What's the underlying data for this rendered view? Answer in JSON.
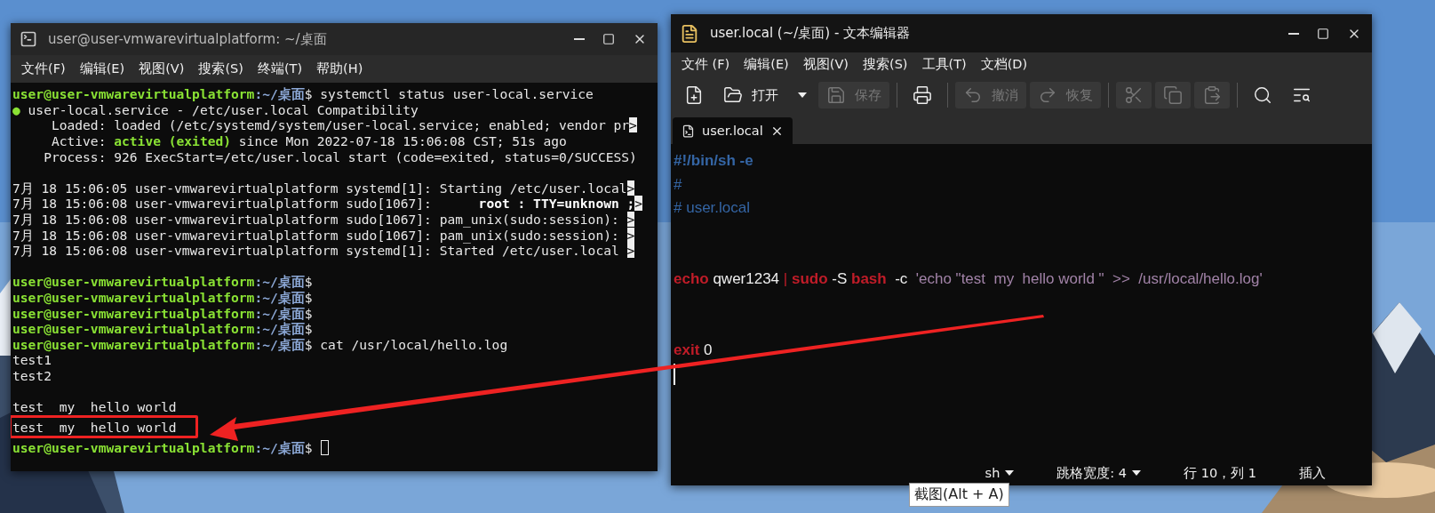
{
  "terminal": {
    "title": "user@user-vmwarevirtualplatform: ~/桌面",
    "menu": [
      "文件(F)",
      "编辑(E)",
      "视图(V)",
      "搜索(S)",
      "终端(T)",
      "帮助(H)"
    ],
    "lines": [
      {
        "kind": "text",
        "segments": [
          {
            "text": "user@user-vmwarevirtualplatform",
            "kind": "user"
          },
          {
            "text": ":~/桌面",
            "kind": "path"
          },
          {
            "text": "$ systemctl status user-local.service",
            "kind": "plain"
          }
        ]
      },
      {
        "kind": "text",
        "segments": [
          {
            "text": "●",
            "kind": "dot"
          },
          {
            "text": " user-local.service - /etc/user.local Compatibility",
            "kind": "plain"
          }
        ]
      },
      {
        "kind": "text",
        "segments": [
          {
            "text": "     Loaded: loaded (/etc/systemd/system/user-local.service; enabled; vendor pr",
            "kind": "plain"
          },
          {
            "text": ">",
            "kind": "more"
          }
        ]
      },
      {
        "kind": "text",
        "segments": [
          {
            "text": "     Active: ",
            "kind": "plain"
          },
          {
            "text": "active (exited)",
            "kind": "active"
          },
          {
            "text": " since Mon 2022-07-18 15:06:08 CST; 51s ago",
            "kind": "plain"
          }
        ]
      },
      {
        "kind": "text",
        "segments": [
          {
            "text": "    Process: 926 ExecStart=/etc/user.local start (code=exited, status=0/SUCCESS)",
            "kind": "plain"
          }
        ]
      },
      {
        "kind": "blank"
      },
      {
        "kind": "text",
        "segments": [
          {
            "text": "7月 18 15:06:05 user-vmwarevirtualplatform systemd[1]: Starting /etc/user.local",
            "kind": "plain"
          },
          {
            "text": ">",
            "kind": "more"
          }
        ]
      },
      {
        "kind": "text",
        "segments": [
          {
            "text": "7月 18 15:06:08 user-vmwarevirtualplatform sudo[1067]:     ",
            "kind": "plain"
          },
          {
            "text": " root : TTY=unknown ;",
            "kind": "bold"
          },
          {
            "text": ">",
            "kind": "more"
          }
        ]
      },
      {
        "kind": "text",
        "segments": [
          {
            "text": "7月 18 15:06:08 user-vmwarevirtualplatform sudo[1067]: pam_unix(sudo:session): ",
            "kind": "plain"
          },
          {
            "text": ">",
            "kind": "more"
          }
        ]
      },
      {
        "kind": "text",
        "segments": [
          {
            "text": "7月 18 15:06:08 user-vmwarevirtualplatform sudo[1067]: pam_unix(sudo:session): ",
            "kind": "plain"
          },
          {
            "text": ">",
            "kind": "more"
          }
        ]
      },
      {
        "kind": "text",
        "segments": [
          {
            "text": "7月 18 15:06:08 user-vmwarevirtualplatform systemd[1]: Started /etc/user.local ",
            "kind": "plain"
          },
          {
            "text": ">",
            "kind": "more"
          }
        ]
      },
      {
        "kind": "blank"
      },
      {
        "kind": "text",
        "segments": [
          {
            "text": "user@user-vmwarevirtualplatform",
            "kind": "user"
          },
          {
            "text": ":~/桌面",
            "kind": "path"
          },
          {
            "text": "$",
            "kind": "plain"
          }
        ]
      },
      {
        "kind": "text",
        "segments": [
          {
            "text": "user@user-vmwarevirtualplatform",
            "kind": "user"
          },
          {
            "text": ":~/桌面",
            "kind": "path"
          },
          {
            "text": "$",
            "kind": "plain"
          }
        ]
      },
      {
        "kind": "text",
        "segments": [
          {
            "text": "user@user-vmwarevirtualplatform",
            "kind": "user"
          },
          {
            "text": ":~/桌面",
            "kind": "path"
          },
          {
            "text": "$",
            "kind": "plain"
          }
        ]
      },
      {
        "kind": "text",
        "segments": [
          {
            "text": "user@user-vmwarevirtualplatform",
            "kind": "user"
          },
          {
            "text": ":~/桌面",
            "kind": "path"
          },
          {
            "text": "$",
            "kind": "plain"
          }
        ]
      },
      {
        "kind": "text",
        "segments": [
          {
            "text": "user@user-vmwarevirtualplatform",
            "kind": "user"
          },
          {
            "text": ":~/桌面",
            "kind": "path"
          },
          {
            "text": "$ cat /usr/local/hello.log",
            "kind": "plain"
          }
        ]
      },
      {
        "kind": "text",
        "segments": [
          {
            "text": "test1",
            "kind": "plain"
          }
        ]
      },
      {
        "kind": "text",
        "segments": [
          {
            "text": "test2",
            "kind": "plain"
          }
        ]
      },
      {
        "kind": "blank"
      },
      {
        "kind": "text",
        "segments": [
          {
            "text": "test  my  hello world",
            "kind": "plain"
          }
        ]
      },
      {
        "kind": "text",
        "highlighted": true,
        "segments": [
          {
            "text": "test  my  hello world",
            "kind": "plain"
          }
        ]
      },
      {
        "kind": "text",
        "segments": [
          {
            "text": "user@user-vmwarevirtualplatform",
            "kind": "user"
          },
          {
            "text": ":~/桌面",
            "kind": "path"
          },
          {
            "text": "$",
            "kind": "plain"
          }
        ],
        "cursor": true
      }
    ]
  },
  "editor": {
    "title": "user.local (~/桌面) - 文本编辑器",
    "menu": [
      "文件 (F)",
      "编辑(E)",
      "视图(V)",
      "搜索(S)",
      "工具(T)",
      "文档(D)"
    ],
    "toolbar": {
      "open": {
        "label": "打开"
      },
      "save": {
        "label": "保存",
        "disabled": true
      },
      "undo": {
        "label": "撤消",
        "disabled": true
      },
      "redo": {
        "label": "恢复",
        "disabled": true
      },
      "cut": {
        "disabled": true
      },
      "copy": {
        "disabled": true
      },
      "paste": {
        "disabled": true
      }
    },
    "tabs": [
      {
        "label": "user.local",
        "selected": true
      }
    ],
    "lines": [
      {
        "kind": "text",
        "tokens": [
          {
            "text": "#!/bin/sh -e",
            "kind": "shebang"
          }
        ]
      },
      {
        "kind": "text",
        "tokens": [
          {
            "text": "#",
            "kind": "comment"
          }
        ]
      },
      {
        "kind": "text",
        "tokens": [
          {
            "text": "# user.local",
            "kind": "comment"
          }
        ]
      },
      {
        "kind": "blank"
      },
      {
        "kind": "blank"
      },
      {
        "kind": "text",
        "tokens": [
          {
            "text": "echo",
            "kind": "keyword"
          },
          {
            "text": " qwer1234 ",
            "kind": "plain"
          },
          {
            "text": "| ",
            "kind": "operator"
          },
          {
            "text": "sudo",
            "kind": "keyword"
          },
          {
            "text": " -S ",
            "kind": "plain"
          },
          {
            "text": "bash",
            "kind": "keyword"
          },
          {
            "text": "  -c  ",
            "kind": "plain"
          },
          {
            "text": "'echo \"test  my  hello world \"  >>  /usr/local/hello.log'",
            "kind": "string"
          }
        ]
      },
      {
        "kind": "blank"
      },
      {
        "kind": "blank"
      },
      {
        "kind": "text",
        "tokens": [
          {
            "text": "exit",
            "kind": "keyword"
          },
          {
            "text": " 0",
            "kind": "plain"
          }
        ]
      },
      {
        "kind": "blank",
        "cursor": true
      }
    ],
    "status": {
      "language": "sh",
      "tab_width": "跳格宽度: 4",
      "position": "行 10，列 1",
      "mode": "插入"
    }
  },
  "tooltip": {
    "text": "截图(Alt + A)"
  }
}
